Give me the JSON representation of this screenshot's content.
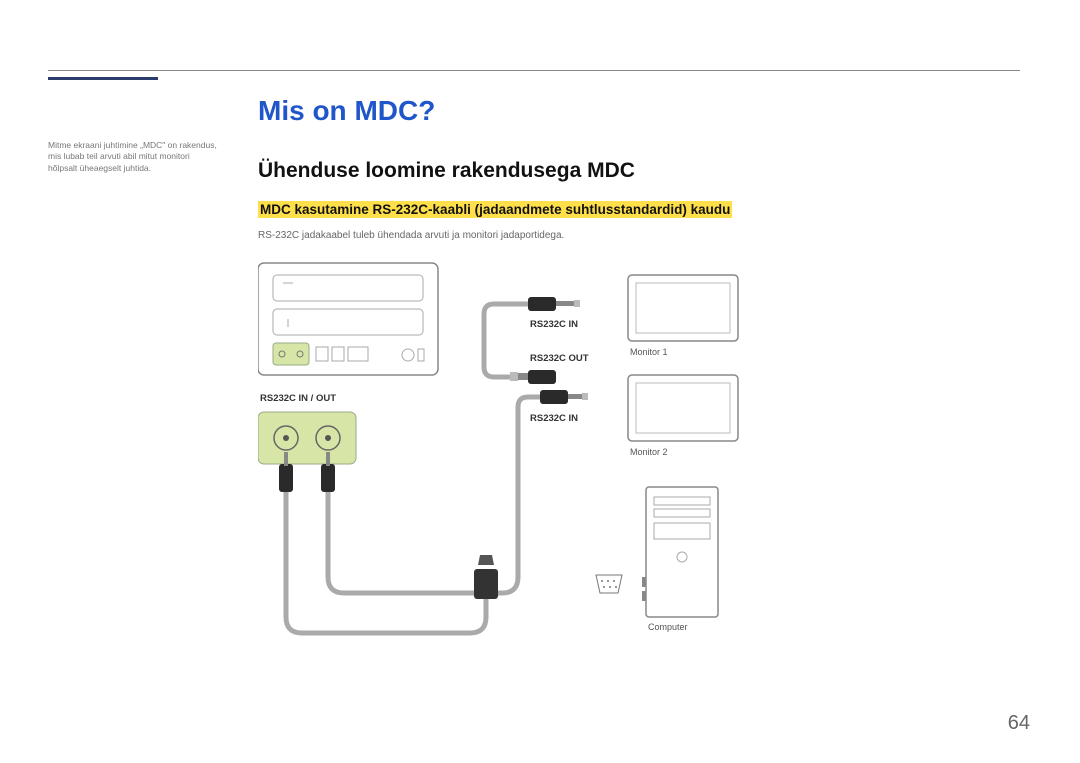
{
  "sidebar_note": "Mitme ekraani juhtimine „MDC\" on rakendus, mis lubab teil arvuti abil mitut monitori hõlpsalt üheaegselt juhtida.",
  "title": "Mis on MDC?",
  "subtitle": "Ühenduse loomine rakendusega MDC",
  "highlight": "MDC kasutamine RS-232C-kaabli (jadaandmete suhtlusstandardid) kaudu",
  "body": "RS-232C jadakaabel tuleb ühendada arvuti ja monitori jadaportidega.",
  "labels": {
    "port_panel": "RS232C IN / OUT",
    "rs_in_1": "RS232C IN",
    "rs_out": "RS232C OUT",
    "rs_in_2": "RS232C IN",
    "mon1": "Monitor 1",
    "mon2": "Monitor 2",
    "computer": "Computer"
  },
  "page_number": "64"
}
